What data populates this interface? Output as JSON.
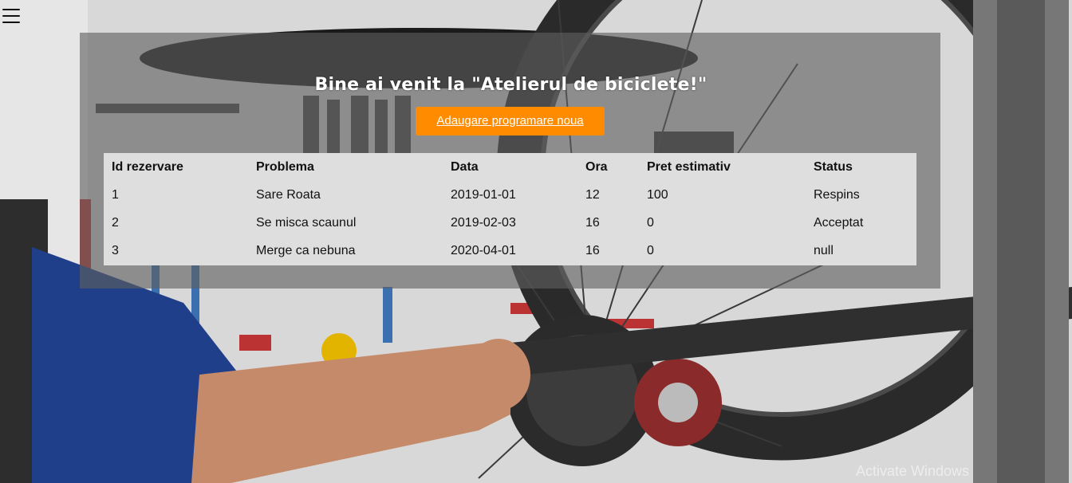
{
  "header": {
    "menu_icon": "hamburger-menu-icon",
    "title": "Bine ai venit la \"Atelierul de biciclete!\""
  },
  "actions": {
    "add_label": "Adaugare programare noua",
    "add_color": "#ff8c00"
  },
  "table": {
    "columns": [
      "Id rezervare",
      "Problema",
      "Data",
      "Ora",
      "Pret estimativ",
      "Status"
    ],
    "rows": [
      [
        "1",
        "Sare Roata",
        "2019-01-01",
        "12",
        "100",
        "Respins"
      ],
      [
        "2",
        "Se misca scaunul",
        "2019-02-03",
        "16",
        "0",
        "Acceptat"
      ],
      [
        "3",
        "Merge ca nebuna",
        "2020-04-01",
        "16",
        "0",
        "null"
      ]
    ]
  },
  "os": {
    "watermark": "Activate Windows"
  }
}
